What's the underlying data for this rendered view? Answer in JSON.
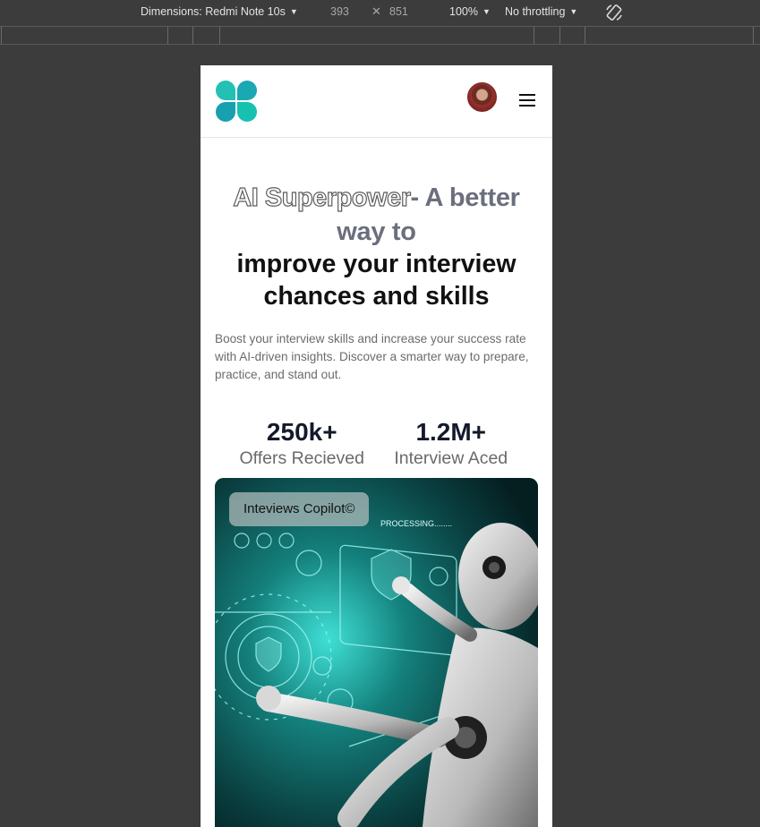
{
  "devtools": {
    "dimensions_label": "Dimensions: Redmi Note 10s",
    "width": "393",
    "times": "✕",
    "height": "851",
    "zoom": "100%",
    "throttling": "No throttling",
    "rotate_icon": "rotate-icon"
  },
  "page": {
    "navbar": {
      "logo_icon": "four-petal-logo",
      "avatar": "user-avatar",
      "menu_icon": "hamburger-menu-icon"
    },
    "hero": {
      "headline_outline": "AI Superpower",
      "headline_gray": "- A better way to",
      "headline_dark": "improve your interview chances and skills",
      "description": "Boost your interview skills and increase your success rate with AI-driven insights. Discover a smarter way to prepare, practice, and stand out."
    },
    "stats": [
      {
        "value": "250k+",
        "label": "Offers Recieved"
      },
      {
        "value": "1.2M+",
        "label": "Interview Aced"
      }
    ],
    "card": {
      "tag": "Inteviews Copilot©",
      "overlay_text": "PROCESSING........"
    }
  },
  "colors": {
    "devtools_bg": "#3c3c3c",
    "accent_teal": "#1fb6b0",
    "headline_gray": "#6b6f7d",
    "stat_value": "#141a2b"
  }
}
